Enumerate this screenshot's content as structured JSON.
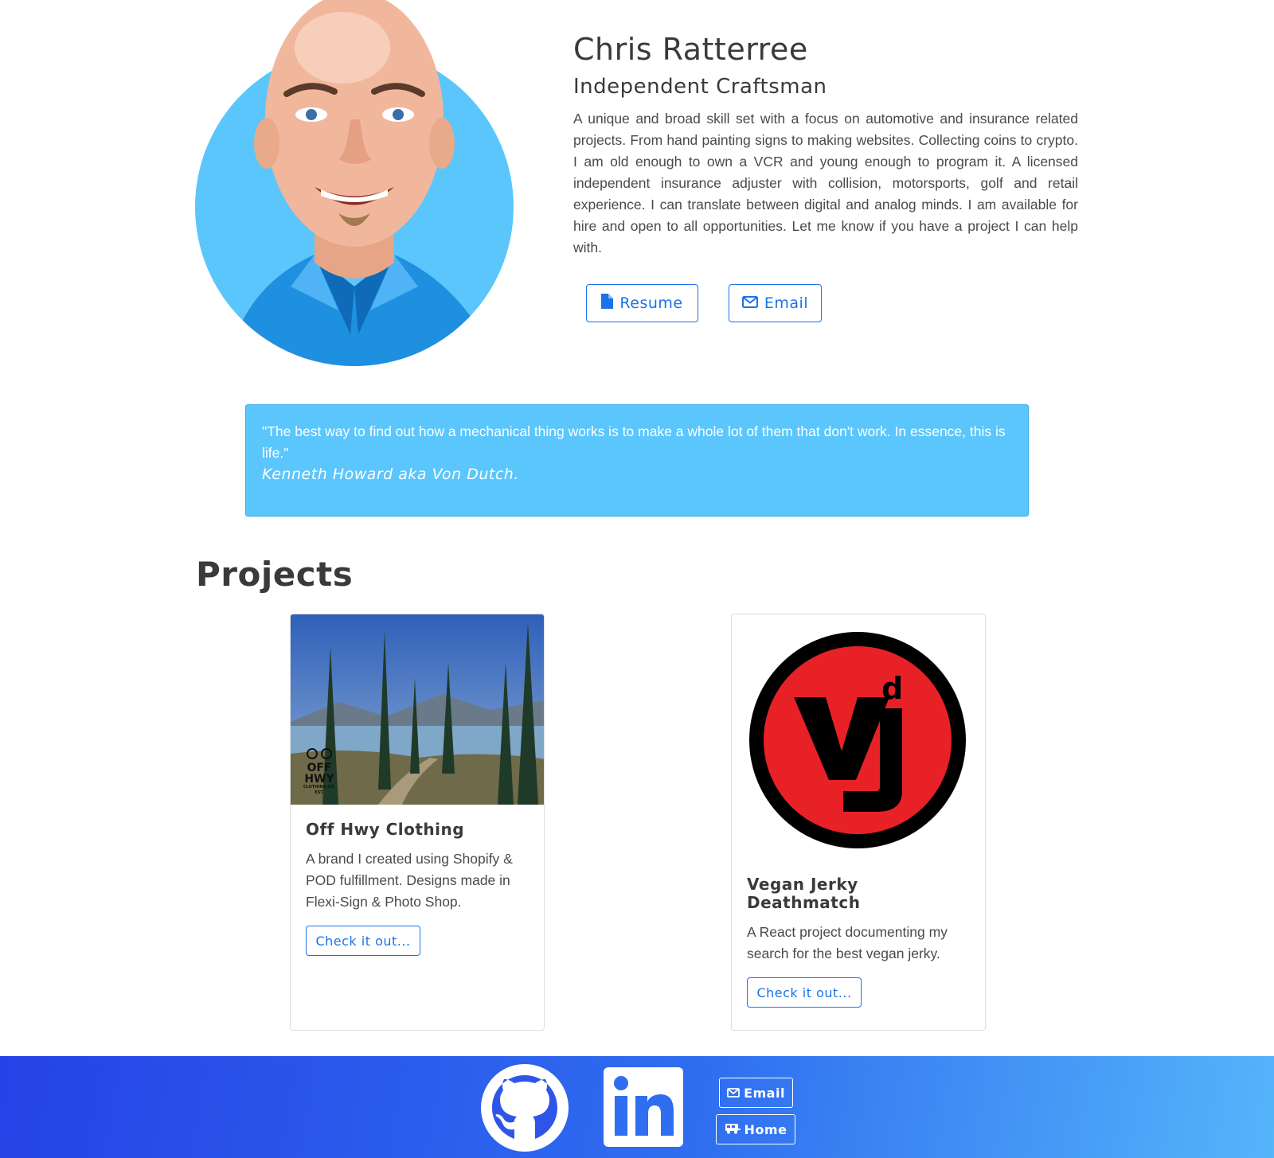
{
  "profile": {
    "name": "Chris Ratterree",
    "title": "Independent Craftsman",
    "bio": "A unique and broad skill set with a focus on automotive and insurance related projects. From hand painting signs to making websites. Collecting coins to crypto. I am old enough to own a VCR and young enough to program it. A licensed independent insurance adjuster with collision, motorsports, golf and retail experience. I can translate between digital and analog minds. I am available for hire and open to all opportunities. Let me know if you have a project I can help with.",
    "resume_label": "Resume",
    "email_label": "Email"
  },
  "quote": {
    "text": "\"The best way to find out how a mechanical thing works is to make a whole lot of them that don't work. In essence, this is life.\"",
    "author": "Kenneth Howard aka Von Dutch."
  },
  "projects": {
    "heading": "Projects",
    "items": [
      {
        "title": "Off Hwy Clothing",
        "description": "A brand I created using Shopify & POD fulfillment. Designs made in Flexi-Sign & Photo Shop.",
        "button_label": "Check it out...",
        "logo_text": [
          "OFF",
          "HWY",
          "CLOTHING CO. EST."
        ]
      },
      {
        "title": "Vegan Jerky Deathmatch",
        "description": "A React project documenting my search for the best vegan jerky.",
        "button_label": "Check it out...",
        "logo_text": "d"
      }
    ]
  },
  "footer": {
    "email_label": "Email",
    "home_label": "Home",
    "icons": [
      "github-icon",
      "linkedin-icon",
      "envelope-icon",
      "rv-icon"
    ]
  },
  "colors": {
    "accent": "#1a73e8",
    "quote_bg": "#5bc6fc",
    "footer_start": "#2542e6",
    "footer_end": "#55b5fa"
  }
}
